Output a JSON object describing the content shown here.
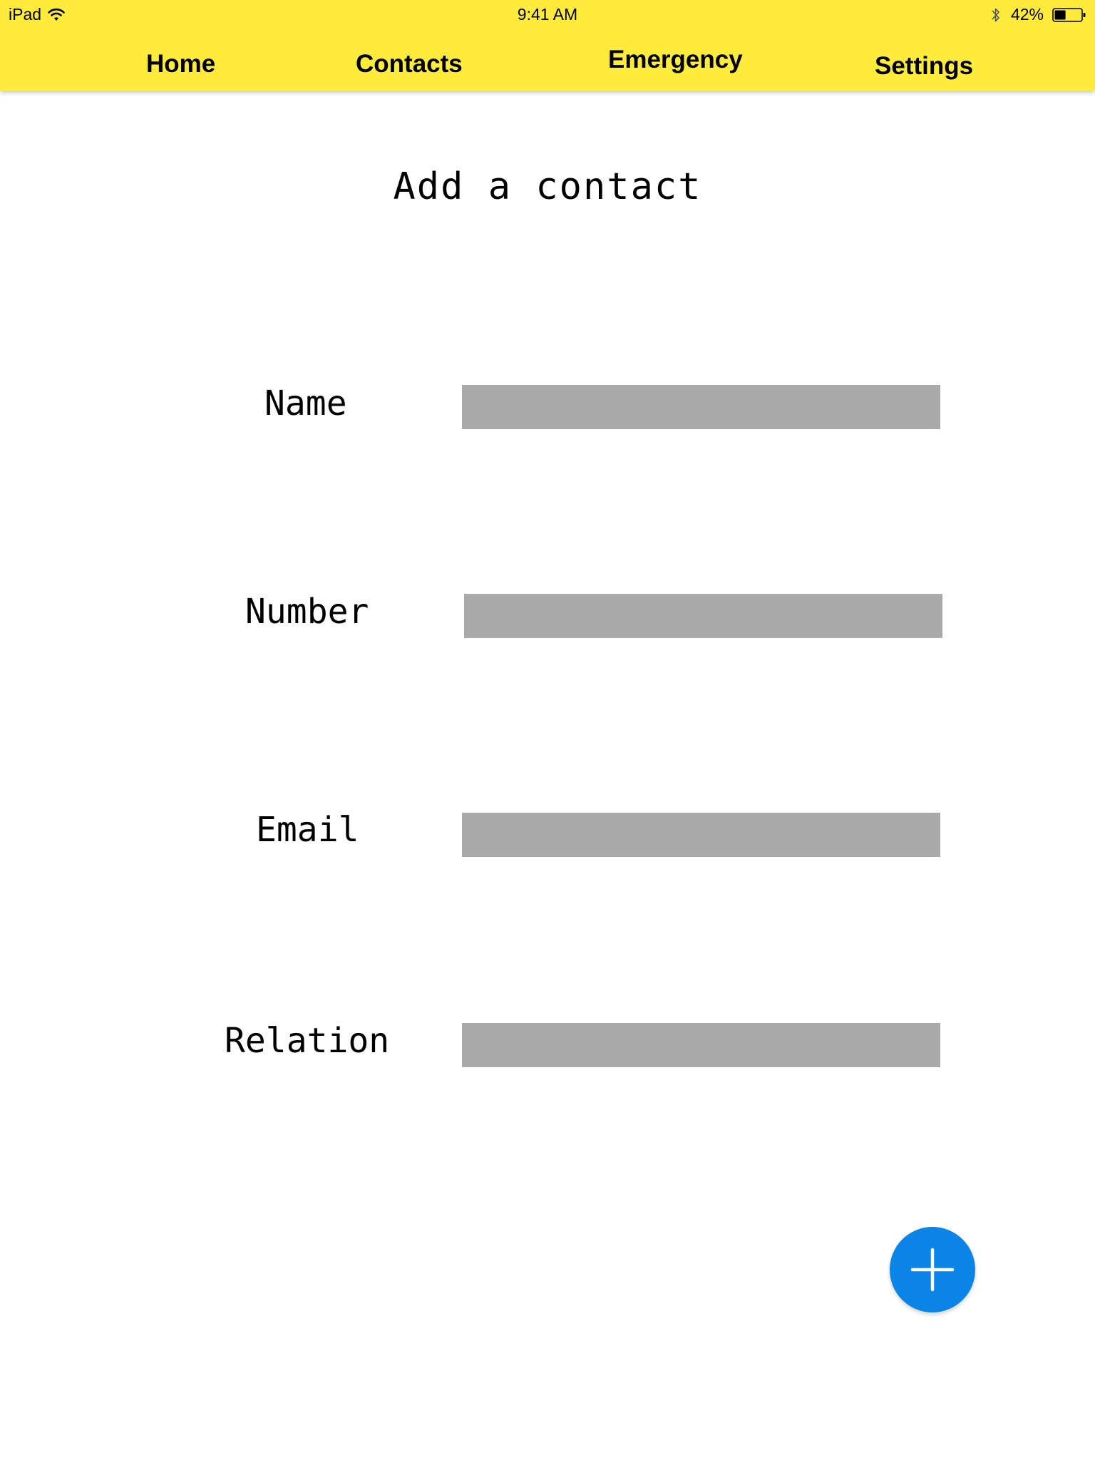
{
  "status_bar": {
    "carrier": "iPad",
    "time": "9:41 AM",
    "battery_percent": "42%",
    "battery_level": 0.42,
    "icons": [
      "wifi-icon",
      "bluetooth-icon",
      "battery-icon"
    ]
  },
  "nav": {
    "items": [
      {
        "label": "Home"
      },
      {
        "label": "Contacts"
      },
      {
        "label": "Emergency"
      },
      {
        "label": "Settings"
      }
    ]
  },
  "form": {
    "title": "Add a contact",
    "fields": [
      {
        "label": "Name",
        "value": ""
      },
      {
        "label": "Number",
        "value": ""
      },
      {
        "label": "Email",
        "value": ""
      },
      {
        "label": "Relation",
        "value": ""
      }
    ],
    "add_button_icon": "plus-icon"
  },
  "colors": {
    "header_background": "#ffeb3b",
    "input_background": "#a9a9a9",
    "fab_background": "#0a84e6"
  }
}
